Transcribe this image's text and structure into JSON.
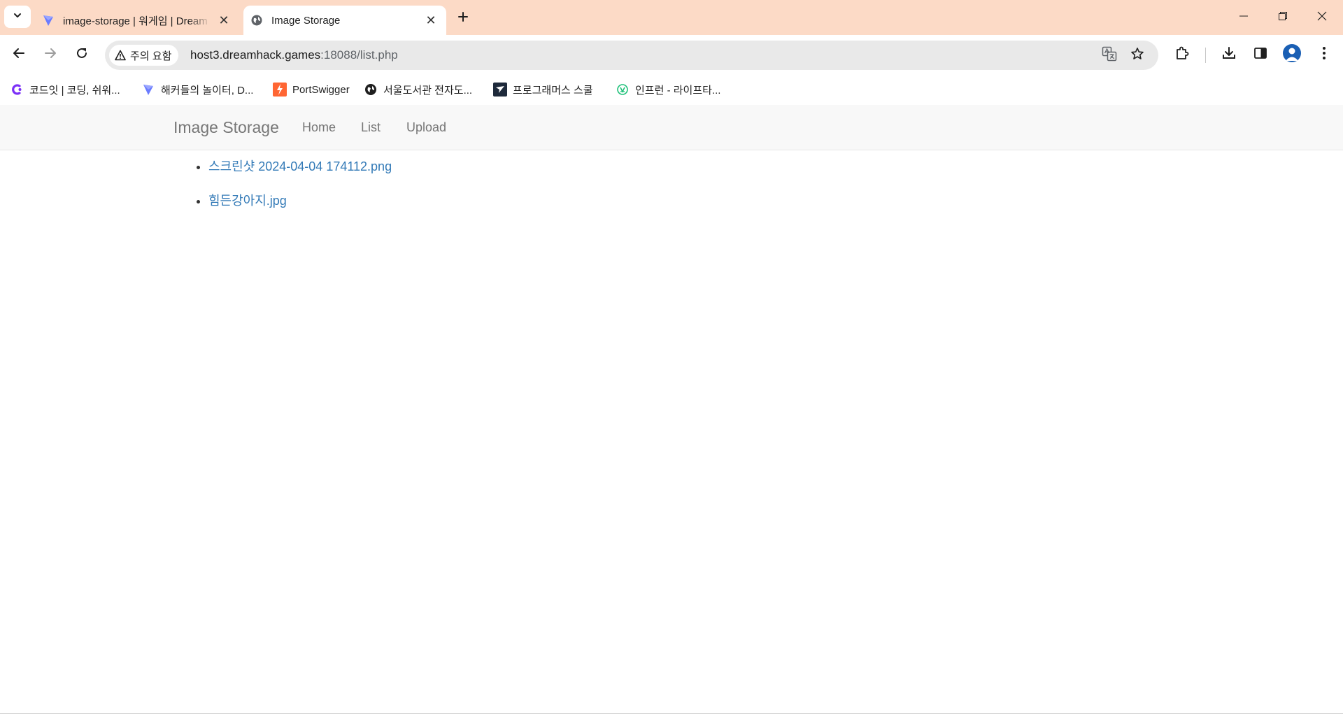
{
  "browser": {
    "tabs": [
      {
        "title": "image-storage | 워게임 | Dream",
        "favicon": "dreamhack-icon",
        "active": false
      },
      {
        "title": "Image Storage",
        "favicon": "globe-icon",
        "active": true
      }
    ],
    "close_glyph": "✕",
    "address": {
      "security_label": "주의 요함",
      "host": "host3.dreamhack.games",
      "path": ":18088/list.php"
    },
    "bookmarks": [
      {
        "label": "코드잇 | 코딩, 쉬워...",
        "icon": "codeit-icon"
      },
      {
        "label": "해커들의 놀이터, D...",
        "icon": "dreamhack-icon"
      },
      {
        "label": "PortSwigger",
        "icon": "portswigger-icon"
      },
      {
        "label": "서울도서관 전자도...",
        "icon": "globe-icon"
      },
      {
        "label": "프로그래머스 스쿨",
        "icon": "programmers-icon"
      },
      {
        "label": "인프런 - 라이프타...",
        "icon": "inflearn-icon"
      }
    ]
  },
  "page": {
    "brand": "Image Storage",
    "nav": [
      {
        "label": "Home"
      },
      {
        "label": "List"
      },
      {
        "label": "Upload"
      }
    ],
    "files": [
      {
        "name": "스크린샷 2024-04-04 174112.png"
      },
      {
        "name": "힘든강아지.jpg"
      }
    ],
    "colors": {
      "tabstrip": "#fcdac6",
      "link": "#337ab7",
      "navbar_bg": "#f8f8f8",
      "navbar_text": "#777777"
    }
  }
}
